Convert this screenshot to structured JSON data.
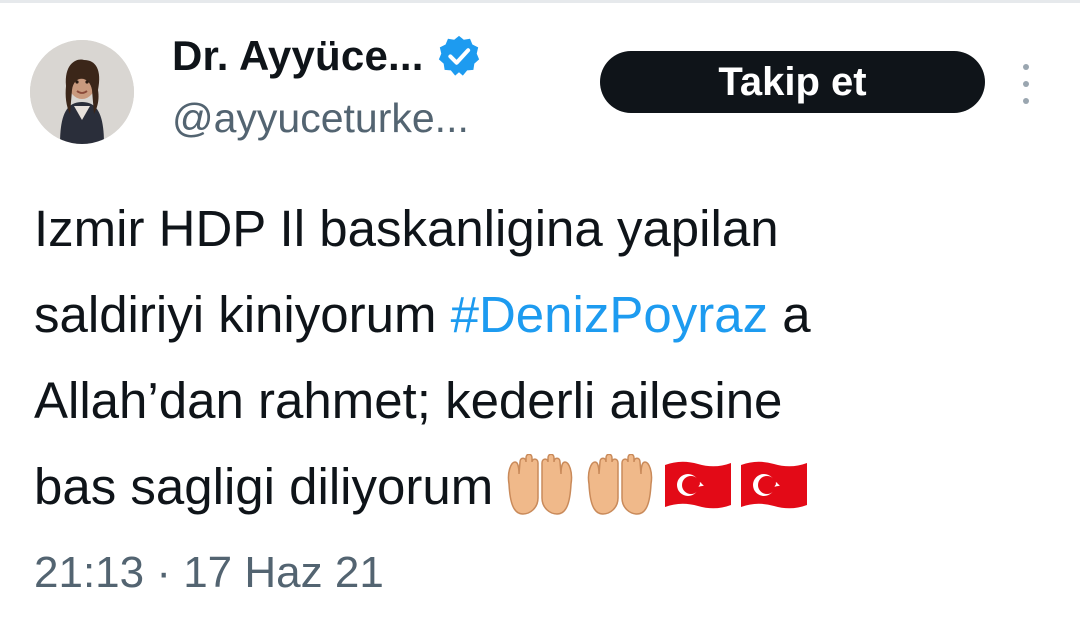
{
  "tweet": {
    "author": {
      "display_name": "Dr. Ayyüce...",
      "handle": "@ayyuceturke...",
      "verified": true,
      "avatar_icon": "profile-photo"
    },
    "follow_label": "Takip et",
    "more_icon": "vertical-dots-icon",
    "text": {
      "line1": "Izmir HDP Il baskanligina yapilan",
      "line2_prefix": "saldiriyi kiniyorum ",
      "hashtag": "#DenizPoyraz",
      "line2_suffix": " a",
      "line3": "Allah’dan rahmet; kederli ailesine",
      "line4": "bas sagligi diliyorum"
    },
    "emojis": [
      "palms-up-together",
      "palms-up-together",
      "flag-turkey",
      "flag-turkey"
    ],
    "timestamp": "21:13 · 17 Haz 21",
    "colors": {
      "link": "#1d9bf0",
      "verified": "#1d9bf0",
      "secondary_text": "#536471",
      "button_bg": "#0f1419"
    }
  }
}
